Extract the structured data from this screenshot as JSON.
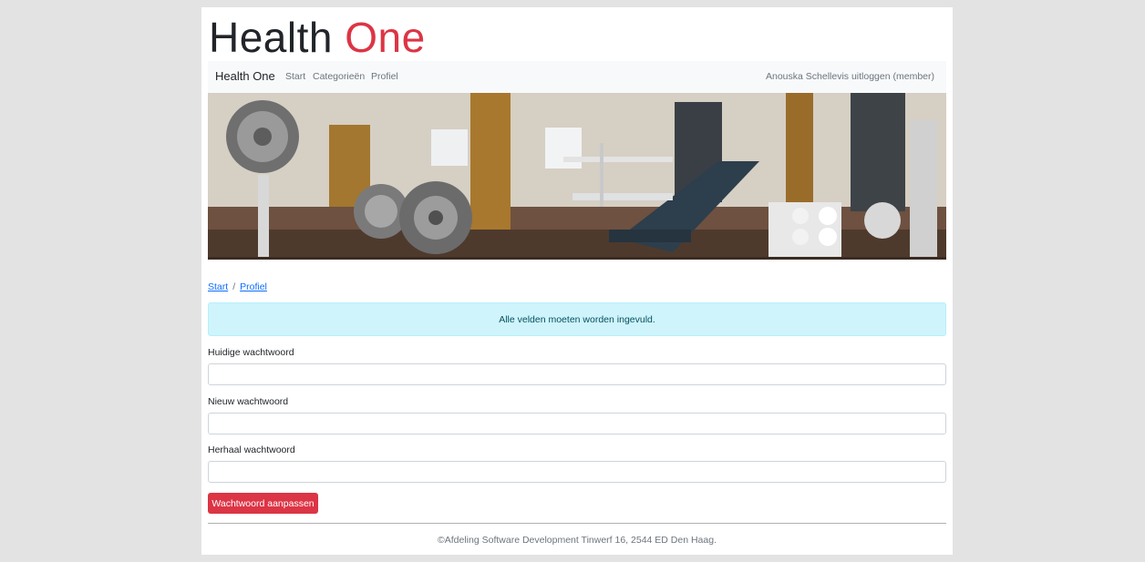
{
  "header": {
    "title_main": "Health ",
    "title_accent": "One"
  },
  "navbar": {
    "brand": "Health One",
    "links": [
      "Start",
      "Categorieën",
      "Profiel"
    ],
    "user": "Anouska Schellevis uitloggen (member)"
  },
  "banner": {
    "icon": "gym-equipment-photo"
  },
  "breadcrumb": {
    "items": [
      "Start",
      "Profiel"
    ],
    "separator": "/"
  },
  "alert": {
    "text": "Alle velden moeten worden ingevuld."
  },
  "form": {
    "fields": [
      {
        "label": "Huidige wachtwoord",
        "value": "",
        "placeholder": ""
      },
      {
        "label": "Nieuw wachtwoord",
        "value": "",
        "placeholder": ""
      },
      {
        "label": "Herhaal wachtwoord",
        "value": "",
        "placeholder": ""
      }
    ],
    "submit_label": "Wachtwoord aanpassen"
  },
  "footer": {
    "text": "©Afdeling Software Development Tinwerf 16, 2544 ED Den Haag."
  },
  "colors": {
    "accent": "#dc3545",
    "alert_bg": "#cff4fc",
    "link": "#0d6efd"
  }
}
